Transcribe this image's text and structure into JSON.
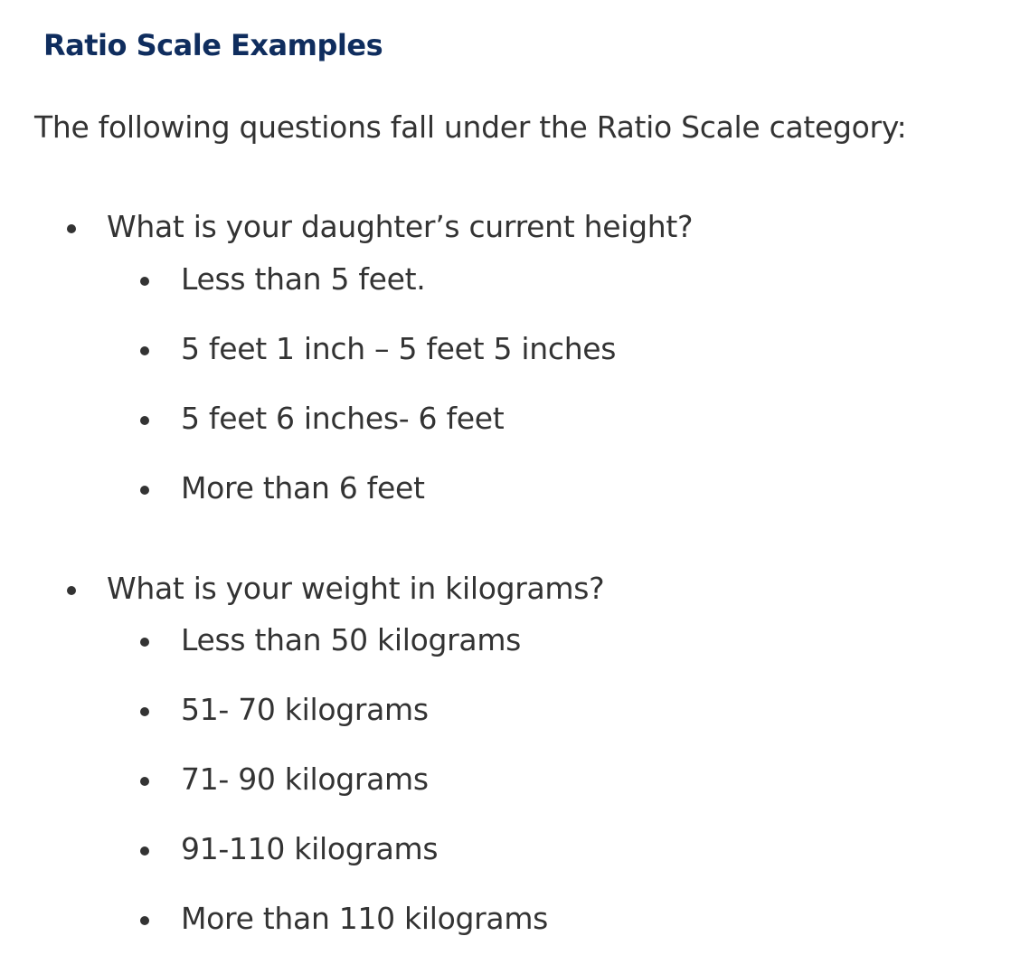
{
  "heading": "Ratio Scale Examples",
  "intro": "The following questions fall under the Ratio Scale category:",
  "questions": [
    {
      "text": "What is your daughter’s current height?",
      "options": [
        "Less than 5 feet.",
        "5 feet 1 inch – 5 feet 5 inches",
        "5 feet 6 inches- 6 feet",
        "More than 6 feet"
      ]
    },
    {
      "text": "What is your weight in kilograms?",
      "options": [
        "Less than 50 kilograms",
        "51- 70 kilograms",
        "71- 90 kilograms",
        "91-110 kilograms",
        "More than 110 kilograms"
      ]
    }
  ]
}
